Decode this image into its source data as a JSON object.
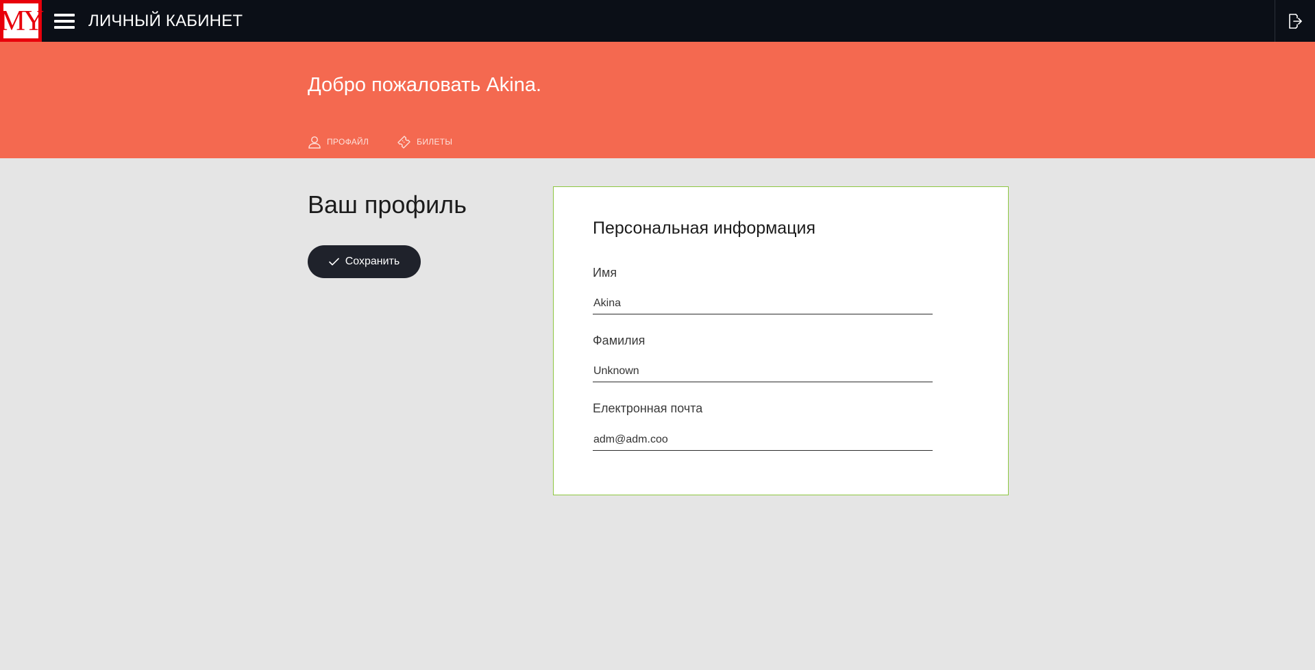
{
  "topbar": {
    "logo_text": "MY",
    "title": "ЛИЧНЫЙ КАБИНЕТ",
    "menu_icon": "hamburger-menu-icon",
    "logout_icon": "logout-icon"
  },
  "banner": {
    "welcome": "Добро пожаловать Akina.",
    "tabs": [
      {
        "label": "ПРОФАЙЛ",
        "icon": "user-icon"
      },
      {
        "label": "БИЛЕТЫ",
        "icon": "ticket-icon"
      }
    ]
  },
  "profile": {
    "heading": "Ваш профиль",
    "save_label": "Сохранить",
    "save_icon": "checkmark-icon"
  },
  "card": {
    "title": "Персональная информация",
    "fields": [
      {
        "label": "Имя",
        "value": "Akina"
      },
      {
        "label": "Фамилия",
        "value": "Unknown"
      },
      {
        "label": "Електронная почта",
        "value": "adm@adm.coo"
      }
    ]
  },
  "colors": {
    "topbar": "#0b0f17",
    "banner": "#f46950",
    "background": "#e5e5e5",
    "card_border": "#8cc63e",
    "logo_red": "#e8000b",
    "button": "#1f222b"
  }
}
